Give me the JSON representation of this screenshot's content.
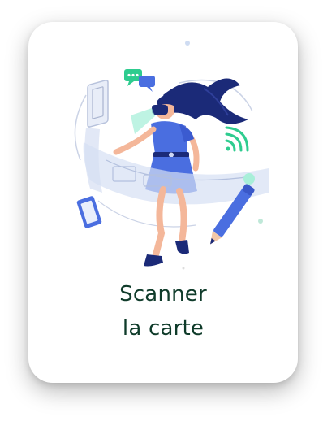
{
  "card": {
    "title_line1": "Scanner",
    "title_line2": "la carte",
    "illustration_icon": "vr-scanner-illustration"
  },
  "colors": {
    "title_text": "#0f3b2a",
    "card_background": "#ffffff",
    "accent_blue": "#4a6ee0",
    "accent_navy": "#1b2a78",
    "accent_green": "#2ecc8f"
  }
}
